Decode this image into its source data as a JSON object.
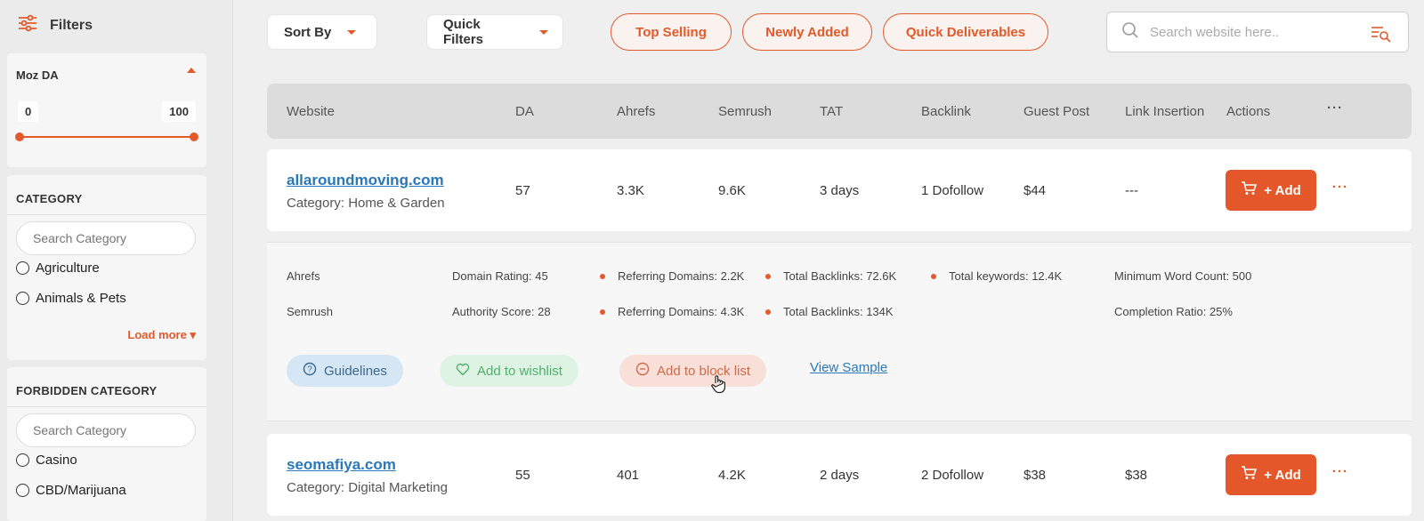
{
  "sidebar": {
    "filters_label": "Filters",
    "moz_da": {
      "title": "Moz DA",
      "min": "0",
      "max": "100"
    },
    "category": {
      "title": "CATEGORY",
      "search_placeholder": "Search Category",
      "options": [
        "Agriculture",
        "Animals & Pets"
      ],
      "load_more": "Load more"
    },
    "forbidden_category": {
      "title": "FORBIDDEN CATEGORY",
      "search_placeholder": "Search Category",
      "options": [
        "Casino",
        "CBD/Marijuana"
      ]
    }
  },
  "toolbar": {
    "sort_by": "Sort By",
    "quick_filters": "Quick Filters",
    "pills": [
      "Top Selling",
      "Newly Added",
      "Quick Deliverables"
    ],
    "search_placeholder": "Search website here.."
  },
  "table": {
    "headers": [
      "Website",
      "DA",
      "Ahrefs",
      "Semrush",
      "TAT",
      "Backlink",
      "Guest Post",
      "Link Insertion",
      "Actions",
      "···"
    ],
    "rows": [
      {
        "website": "allaroundmoving.com",
        "category": "Category: Home & Garden",
        "da": "57",
        "ahrefs": "3.3K",
        "semrush": "9.6K",
        "tat": "3 days",
        "backlink": "1 Dofollow",
        "guest_post": "$44",
        "link_insertion": "---",
        "action": "+ Add"
      },
      {
        "website": "seomafiya.com",
        "category": "Category: Digital Marketing",
        "da": "55",
        "ahrefs": "401",
        "semrush": "4.2K",
        "tat": "2 days",
        "backlink": "2 Dofollow",
        "guest_post": "$38",
        "link_insertion": "$38",
        "action": "+ Add"
      }
    ],
    "more_dots": "···"
  },
  "detail": {
    "ahrefs_label": "Ahrefs",
    "semrush_label": "Semrush",
    "ahrefs_domain_rating": "Domain Rating: 45",
    "ahrefs_referring_domains": "Referring Domains: 2.2K",
    "ahrefs_total_backlinks": "Total Backlinks: 72.6K",
    "ahrefs_total_keywords": "Total keywords: 12.4K",
    "min_word_count": "Minimum Word Count: 500",
    "semrush_authority_score": "Authority Score: 28",
    "semrush_referring_domains": "Referring Domains: 4.3K",
    "semrush_total_backlinks": "Total Backlinks: 134K",
    "completion_ratio": "Completion Ratio: 25%",
    "guidelines": "Guidelines",
    "add_to_wishlist": "Add to wishlist",
    "add_to_block_list": "Add to block list",
    "view_sample": "View Sample"
  },
  "colors": {
    "accent": "#e4572a",
    "link": "#2a78b8"
  }
}
